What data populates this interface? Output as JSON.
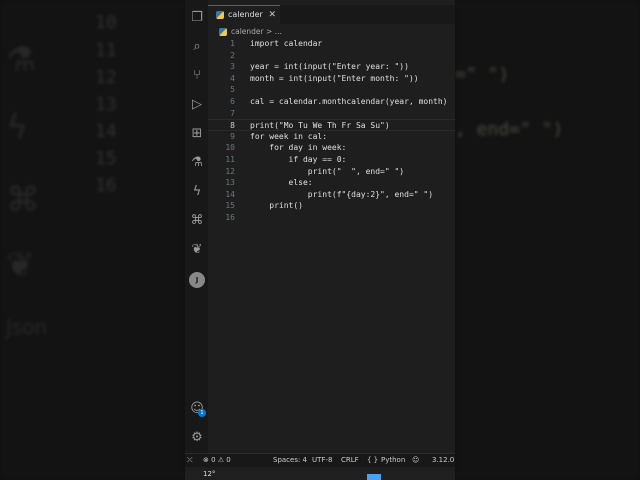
{
  "background_left": {
    "line_numbers": [
      "10",
      "11",
      "12",
      "13",
      "14",
      "15",
      "16"
    ]
  },
  "background_right": {
    "fragments": [
      "=\" \")",
      ", end=\" \")"
    ]
  },
  "activity_bar": {
    "items": [
      {
        "icon": "files-icon",
        "glyph": "❐"
      },
      {
        "icon": "search-icon",
        "glyph": "⌕"
      },
      {
        "icon": "source-control-icon",
        "glyph": "⑂"
      },
      {
        "icon": "run-debug-icon",
        "glyph": "▷"
      },
      {
        "icon": "extensions-icon",
        "glyph": "⊞"
      },
      {
        "icon": "testing-icon",
        "glyph": "⚗"
      },
      {
        "icon": "lightning-icon",
        "glyph": "ϟ"
      },
      {
        "icon": "python-icon",
        "glyph": "⌘"
      },
      {
        "icon": "mongodb-leaf-icon",
        "glyph": "❦"
      },
      {
        "icon": "json-icon",
        "glyph": "J"
      }
    ],
    "account_badge": "1",
    "settings_icon": "gear-icon"
  },
  "tab": {
    "label": "calender",
    "close": "✕"
  },
  "breadcrumb": {
    "file": "calender",
    "sep": ">",
    "rest": "..."
  },
  "editor": {
    "current_line": 8,
    "lines": [
      "import calendar",
      "",
      "year = int(input(\"Enter year: \"))",
      "month = int(input(\"Enter month: \"))",
      "",
      "cal = calendar.monthcalendar(year, month)",
      "",
      "print(\"Mo Tu We Th Fr Sa Su\")",
      "for week in cal:",
      "    for day in week:",
      "        if day == 0:",
      "            print(\"  \", end=\" \")",
      "        else:",
      "            print(f\"{day:2}\", end=\" \")",
      "    print()",
      ""
    ]
  },
  "status_bar": {
    "remote": "⤫",
    "errors": "0",
    "warnings": "0",
    "spaces": "Spaces: 4",
    "encoding": "UTF-8",
    "eol": "CRLF",
    "language_braces": "{ }",
    "language": "Python",
    "copilot": "☺",
    "version": "3.12.0"
  },
  "taskbar": {
    "weather": "12°"
  },
  "colors": {
    "accent": "#0078d4",
    "editor_bg": "#1e1e1e",
    "sidebar_bg": "#181818"
  }
}
